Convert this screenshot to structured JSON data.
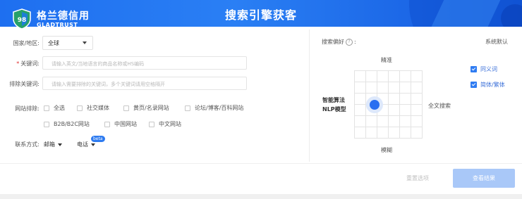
{
  "header": {
    "title": "搜索引擎获客",
    "logo_text": "格兰德信用",
    "logo_sub": "GLADTRUST",
    "logo_badge": "98"
  },
  "form": {
    "country": {
      "label": "国家/地区:",
      "value": "全球"
    },
    "keyword": {
      "required_mark": "*",
      "label": "关键词:",
      "placeholder": "请输入英文/当地语言的商品名称或HS编码"
    },
    "exclude": {
      "label": "排除关键词:",
      "placeholder": "请输入需要排除的关键词，多个关键词请用空格隔开"
    },
    "site_exclude": {
      "label": "网站排除:",
      "options": [
        "全选",
        "社交媒体",
        "黄页/名录网站",
        "论坛/博客/百科网站",
        "B2B/B2C网站",
        "中国网站",
        "中文网站"
      ]
    },
    "contact": {
      "label": "联系方式:",
      "email": "邮箱",
      "phone": "电话",
      "phone_badge": "beta"
    }
  },
  "preference": {
    "label": "搜索偏好",
    "help_icon": "?",
    "suffix": ":",
    "default": "系统默认",
    "axis_top": "精准",
    "axis_bottom": "模糊",
    "axis_left_line1": "智能算法",
    "axis_left_line2": "NLP模型",
    "axis_right": "全文搜索",
    "options": [
      {
        "label": "同义词",
        "checked": true
      },
      {
        "label": "简体/繁体",
        "checked": true
      }
    ]
  },
  "actions": {
    "reset": "重置选项",
    "search": "查看结果"
  },
  "colors": {
    "primary": "#2a6ff0",
    "header": "#1e6ff0",
    "disabled_button": "#a9c8f8"
  }
}
